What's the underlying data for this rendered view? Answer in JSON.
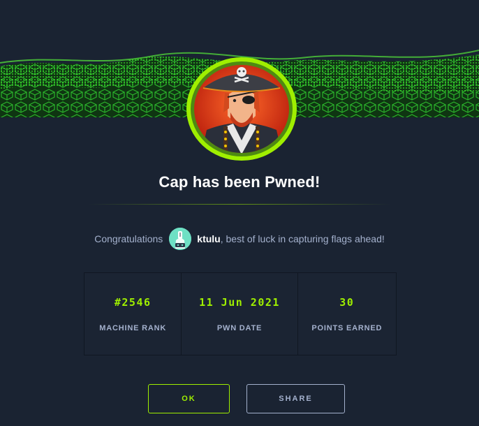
{
  "modal": {
    "title": "Cap has been Pwned!",
    "congrats_prefix": "Congratulations",
    "username": "ktulu",
    "congrats_suffix": ", best of luck in capturing flags ahead!"
  },
  "stats": [
    {
      "value": "#2546",
      "label": "MACHINE RANK"
    },
    {
      "value": "11 Jun 2021",
      "label": "PWN DATE"
    },
    {
      "value": "30",
      "label": "POINTS EARNED"
    }
  ],
  "buttons": {
    "ok": "OK",
    "share": "SHARE"
  },
  "colors": {
    "background": "#1a2332",
    "accent": "#9fef00",
    "muted_text": "#a4b1cd"
  },
  "icons": {
    "banner": "hex-grid-wave",
    "machine_avatar": "pirate-captain-avatar",
    "user_avatar": "robot-avatar"
  }
}
